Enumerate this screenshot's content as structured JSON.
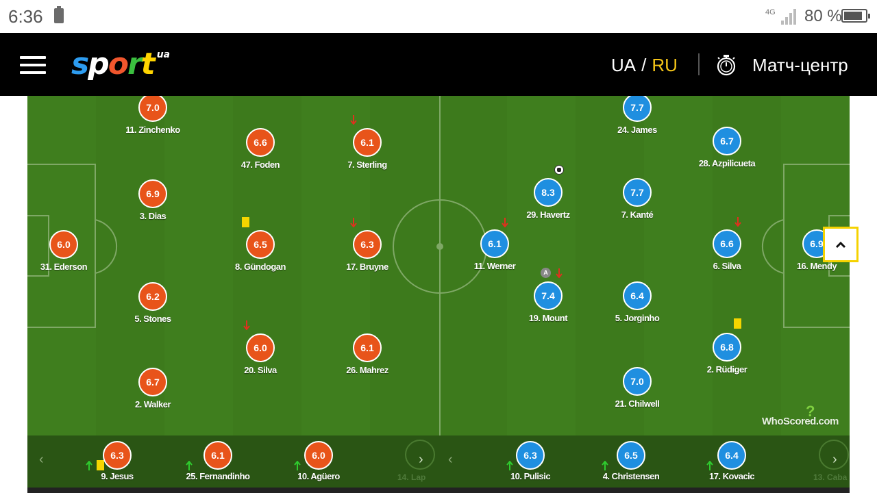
{
  "status_bar": {
    "time": "6:36",
    "network": "4G",
    "battery_pct": "80 %",
    "battery_level": 0.8
  },
  "header": {
    "logo": {
      "main": "sport",
      "suffix": "ua"
    },
    "lang_ua": "UA",
    "lang_sep": "/",
    "lang_ru": "RU",
    "match_center": "Матч-центр",
    "icons": {
      "menu": "hamburger-menu-icon",
      "match_center": "stopwatch-icon"
    }
  },
  "pitch": {
    "colors": {
      "grass": "#3d7a1c",
      "home": "#e8541a",
      "away": "#1f8fe0",
      "card": "#f5d500"
    },
    "home": [
      {
        "rating": "7.0",
        "name": "11. Zinchenko"
      },
      {
        "rating": "6.6",
        "name": "47. Foden"
      },
      {
        "rating": "6.1",
        "name": "7. Sterling"
      },
      {
        "rating": "6.9",
        "name": "3. Dias"
      },
      {
        "rating": "6.0",
        "name": "31. Ederson"
      },
      {
        "rating": "6.5",
        "name": "8. Gündogan"
      },
      {
        "rating": "6.3",
        "name": "17. Bruyne"
      },
      {
        "rating": "6.2",
        "name": "5. Stones"
      },
      {
        "rating": "6.0",
        "name": "20. Silva"
      },
      {
        "rating": "6.1",
        "name": "26. Mahrez"
      },
      {
        "rating": "6.7",
        "name": "2. Walker"
      }
    ],
    "away": [
      {
        "rating": "7.7",
        "name": "24. James"
      },
      {
        "rating": "6.7",
        "name": "28. Azpilicueta"
      },
      {
        "rating": "8.3",
        "name": "29. Havertz"
      },
      {
        "rating": "7.7",
        "name": "7. Kanté"
      },
      {
        "rating": "6.1",
        "name": "11. Werner"
      },
      {
        "rating": "6.6",
        "name": "6. Silva"
      },
      {
        "rating": "6.9",
        "name": "16. Mendy"
      },
      {
        "rating": "7.4",
        "name": "19. Mount"
      },
      {
        "rating": "6.4",
        "name": "5. Jorginho"
      },
      {
        "rating": "6.8",
        "name": "2. Rüdiger"
      },
      {
        "rating": "7.0",
        "name": "21. Chilwell"
      }
    ],
    "assist_badge": "A",
    "watermark": "WhoScored.com"
  },
  "bench": {
    "home": [
      {
        "rating": "6.3",
        "name": "9. Jesus"
      },
      {
        "rating": "6.1",
        "name": "25. Fernandinho"
      },
      {
        "rating": "6.0",
        "name": "10. Agüero"
      }
    ],
    "home_partial": "14. Lap",
    "away": [
      {
        "rating": "6.3",
        "name": "10. Pulisic"
      },
      {
        "rating": "6.5",
        "name": "4. Christensen"
      },
      {
        "rating": "6.4",
        "name": "17. Kovacic"
      }
    ],
    "away_partial": "13. Caba"
  }
}
